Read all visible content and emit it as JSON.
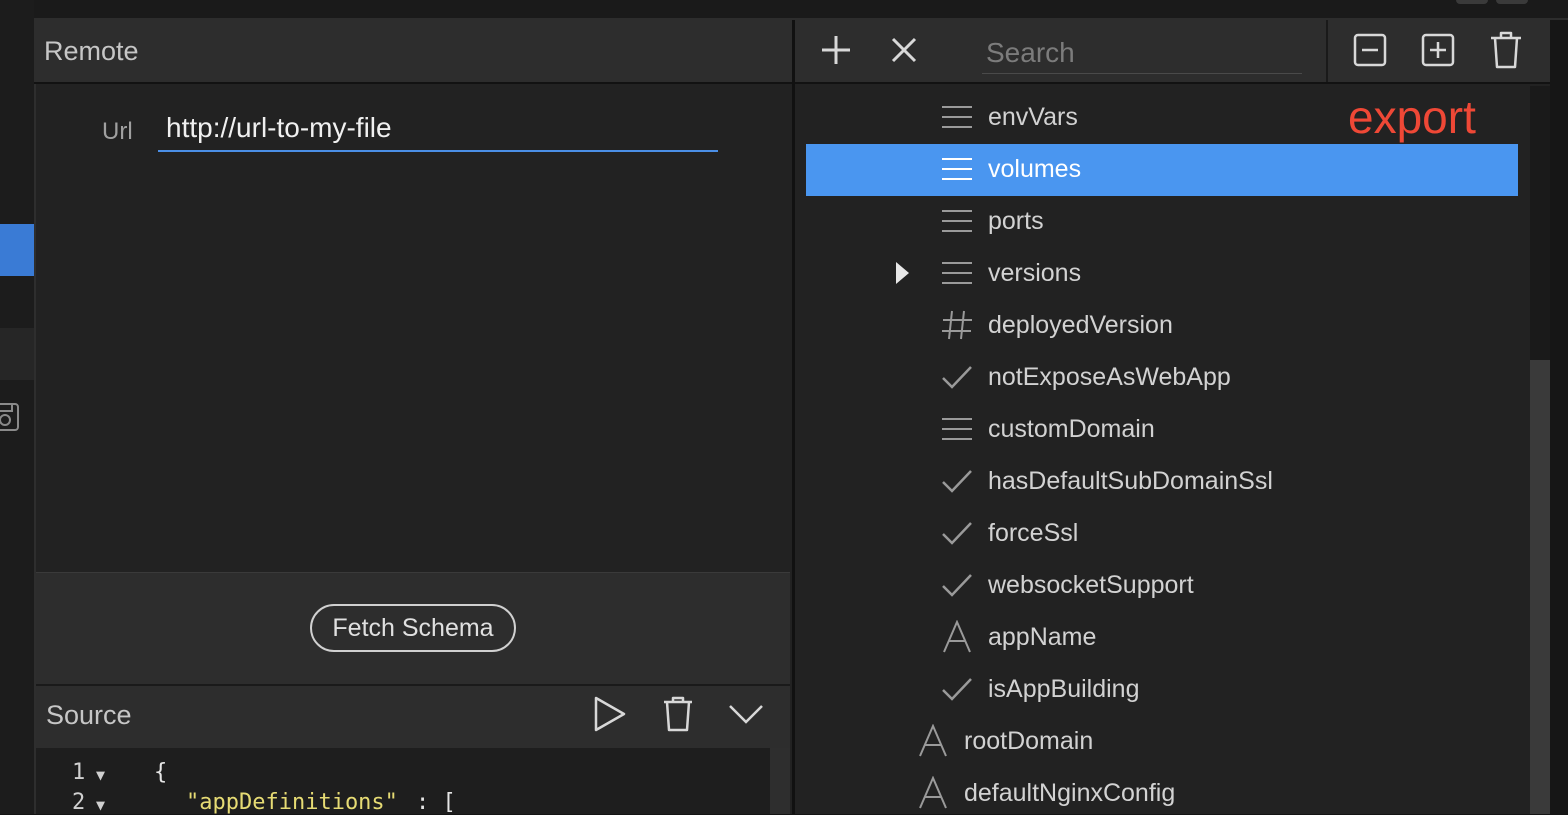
{
  "remote": {
    "title": "Remote",
    "url_label": "Url",
    "url_value": "http://url-to-my-file",
    "fetch_button": "Fetch Schema"
  },
  "source": {
    "title": "Source",
    "lines": [
      {
        "num": "1",
        "text": "{"
      },
      {
        "num": "2",
        "key": "\"appDefinitions\"",
        "rest": ": ["
      }
    ]
  },
  "tree_toolbar": {
    "search_placeholder": "Search"
  },
  "annotation": "export",
  "tree": {
    "selected": "volumes",
    "items": [
      {
        "label": "envVars",
        "icon": "list-icon"
      },
      {
        "label": "volumes",
        "icon": "list-icon"
      },
      {
        "label": "ports",
        "icon": "list-icon"
      },
      {
        "label": "versions",
        "icon": "list-icon",
        "expandable": true
      },
      {
        "label": "deployedVersion",
        "icon": "hash-icon"
      },
      {
        "label": "notExposeAsWebApp",
        "icon": "check-icon"
      },
      {
        "label": "customDomain",
        "icon": "list-icon"
      },
      {
        "label": "hasDefaultSubDomainSsl",
        "icon": "check-icon"
      },
      {
        "label": "forceSsl",
        "icon": "check-icon"
      },
      {
        "label": "websocketSupport",
        "icon": "check-icon"
      },
      {
        "label": "appName",
        "icon": "string-icon"
      },
      {
        "label": "isAppBuilding",
        "icon": "check-icon"
      },
      {
        "label": "rootDomain",
        "icon": "string-icon"
      },
      {
        "label": "defaultNginxConfig",
        "icon": "string-icon"
      }
    ]
  },
  "colors": {
    "accent": "#4a96f0",
    "annotation": "#ef4836",
    "string": "#e6db74"
  }
}
